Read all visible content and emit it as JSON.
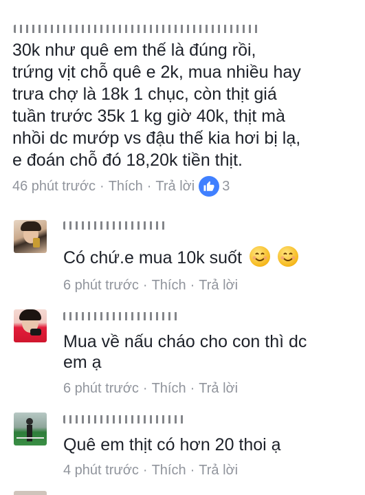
{
  "main_comment": {
    "lines": [
      "30k như quê em thế là đúng rồi,",
      "trứng vịt chỗ quê e 2k, mua nhiều hay",
      "trưa chợ là 18k 1 chục, còn thịt giá",
      "tuần trước 35k 1 kg giờ 40k, thịt mà",
      "nhồi dc mướp vs đậu thế kia hơi bị lạ,",
      "e đoán chỗ đó 18,20k tiền thịt."
    ],
    "time": "46 phút trước",
    "like_label": "Thích",
    "reply_label": "Trả lời",
    "like_count": "3"
  },
  "replies": [
    {
      "text": "Có chứ.e mua 10k suốt",
      "time": "6 phút trước",
      "like_label": "Thích",
      "reply_label": "Trả lời"
    },
    {
      "text_lines": [
        "Mua về nấu cháo cho con thì dc",
        "em ạ"
      ],
      "time": "6 phút trước",
      "like_label": "Thích",
      "reply_label": "Trả lời"
    },
    {
      "text": "Quê em thịt có hơn 20 thoi ạ",
      "time": "4 phút trước",
      "like_label": "Thích",
      "reply_label": "Trả lời"
    }
  ],
  "separator": "·",
  "colors": {
    "text": "#1d2129",
    "meta": "#90949c",
    "like_badge": "#4080ff"
  },
  "icons": [
    "thumbs-up-icon",
    "smiling-emoji-icon"
  ]
}
